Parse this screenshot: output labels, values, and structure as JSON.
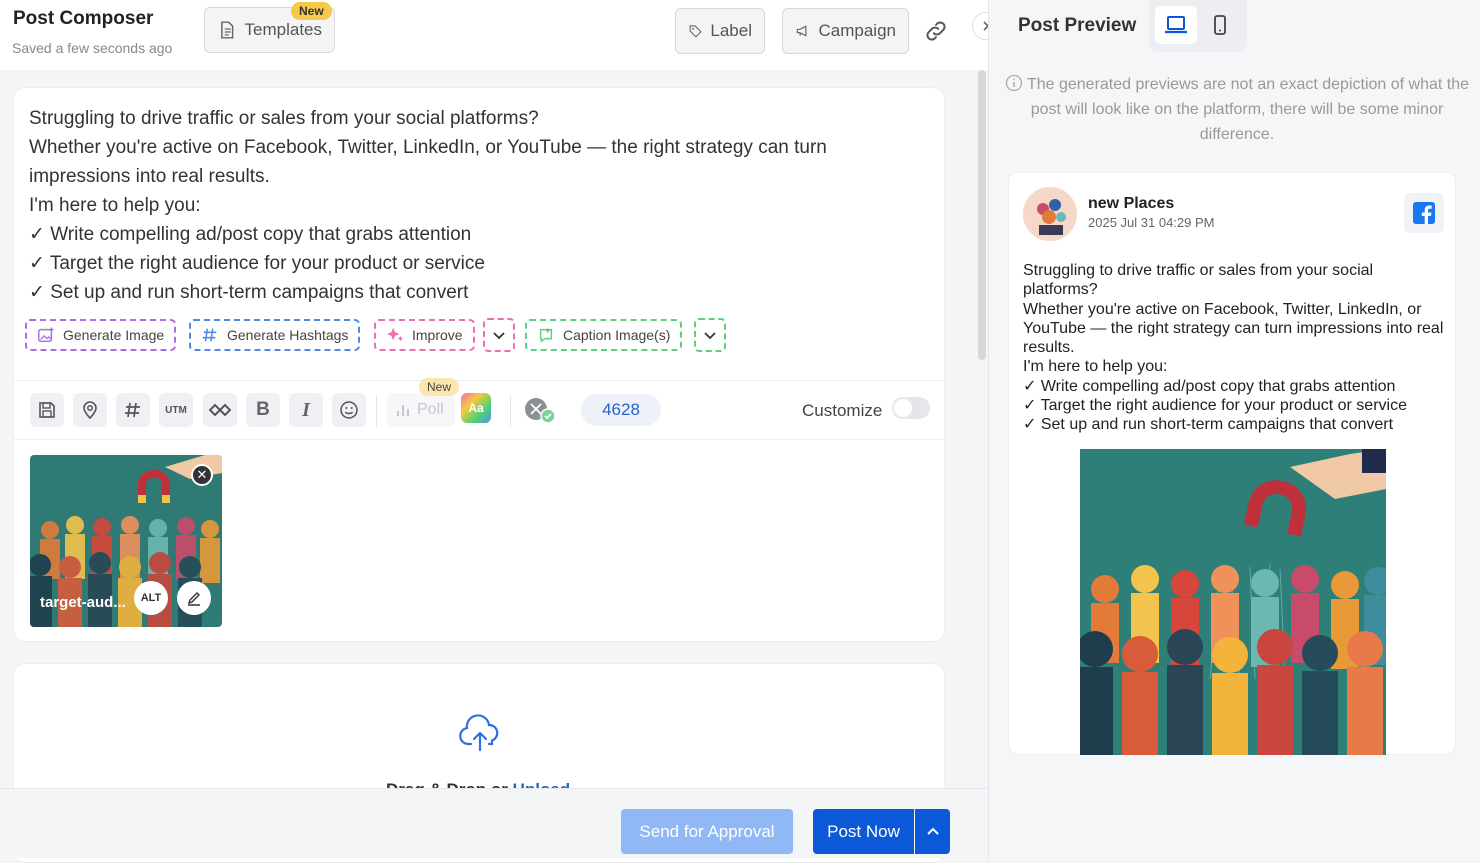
{
  "composer": {
    "title": "Post Composer",
    "saved_status": "Saved a few seconds ago",
    "templates_label": "Templates",
    "templates_badge": "New",
    "label_btn": "Label",
    "campaign_btn": "Campaign"
  },
  "post": {
    "lines": [
      "Struggling to drive traffic or sales from your social platforms?",
      "Whether you're active on Facebook, Twitter, LinkedIn, or YouTube — the right strategy can turn impressions into real results.",
      "I'm here to help you:",
      "✓ Write compelling ad/post copy that grabs attention",
      "✓ Target the right audience for your product or service",
      "✓ Set up and run short-term campaigns that convert"
    ]
  },
  "ai_actions": {
    "generate_image": "Generate Image",
    "generate_hashtags": "Generate Hashtags",
    "improve": "Improve",
    "caption_images": "Caption Image(s)"
  },
  "toolbar": {
    "utm": "UTM",
    "bold": "B",
    "italic": "I",
    "poll": "Poll",
    "poll_badge": "New",
    "font_style": "Aa",
    "char_count": "4628",
    "customize": "Customize"
  },
  "media": {
    "filename": "target-aud...",
    "alt_label": "ALT"
  },
  "upload": {
    "prefix": "Drag & Drop or ",
    "link": "Upload"
  },
  "footer": {
    "approval": "Send for Approval",
    "post_now": "Post Now"
  },
  "preview": {
    "title": "Post Preview",
    "notice": "The generated previews are not an exact depiction of what the post will look like on the platform, there will be some minor difference.",
    "account": "new Places",
    "date": "2025 Jul 31 04:29 PM",
    "text_lines": [
      "Struggling to drive traffic or sales from your social platforms?",
      "Whether you're active on Facebook, Twitter, LinkedIn, or YouTube — the right strategy can turn impressions into real results.",
      "I'm here to help you:",
      "✓ Write compelling ad/post copy that grabs attention",
      "✓ Target the right audience for your product or service",
      "✓ Set up and run short-term campaigns that convert"
    ]
  },
  "colors": {
    "primary": "#0b59d9",
    "approval_disabled": "#8fb8f5",
    "badge": "#f7c84a",
    "generate_image_border": "#a76ee8",
    "hashtags_border": "#4f8ae6",
    "improve_border": "#ec6fb4",
    "caption_border": "#5fcf7d",
    "facebook": "#1877f2"
  }
}
